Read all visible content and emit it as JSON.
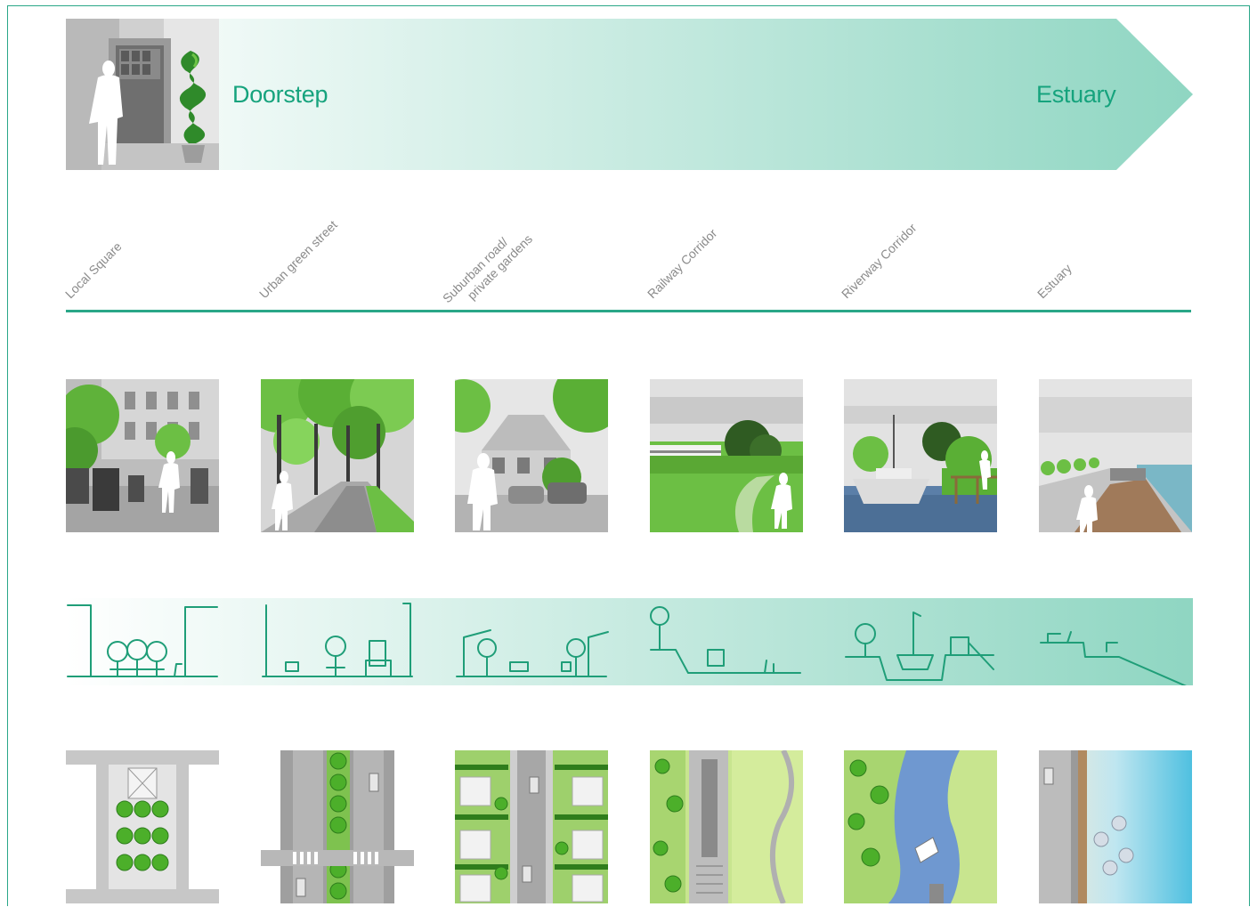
{
  "banner": {
    "left_label": "Doorstep",
    "right_label": "Estuary"
  },
  "columns": [
    {
      "label_line1": "Local Square",
      "label_line2": ""
    },
    {
      "label_line1": "Urban green street",
      "label_line2": ""
    },
    {
      "label_line1": "Suburban road/",
      "label_line2": "private gardens"
    },
    {
      "label_line1": "Railway Corridor",
      "label_line2": ""
    },
    {
      "label_line1": "Riverway Corridor",
      "label_line2": ""
    },
    {
      "label_line1": "Estuary",
      "label_line2": ""
    }
  ],
  "colors": {
    "accent": "#2aa788",
    "banner_light": "#ffffff",
    "banner_dark": "#8fd6c2",
    "tree": "#4caf2a",
    "water": "#5b8ecf"
  },
  "icons": [
    "person-silhouette-icon",
    "topiary-tree-icon"
  ]
}
